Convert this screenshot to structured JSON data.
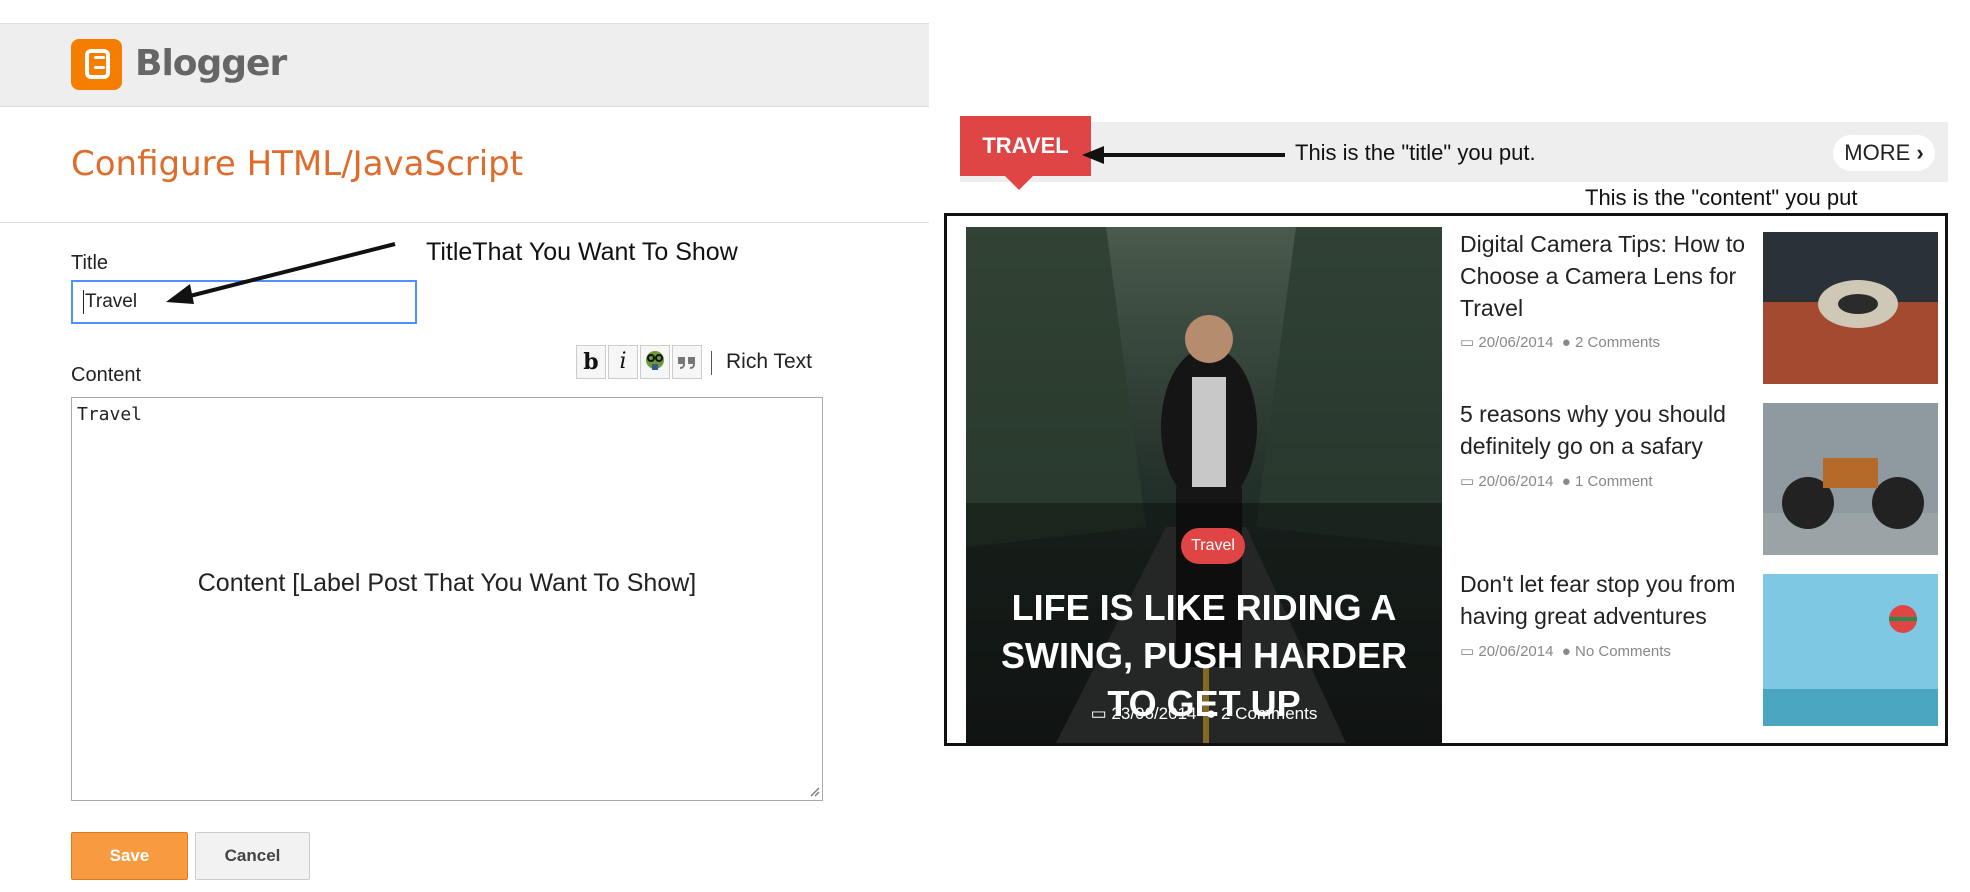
{
  "blogger": {
    "brand": "Blogger",
    "page_title": "Configure HTML/JavaScript",
    "title_label": "Title",
    "title_value": "Travel",
    "content_label": "Content",
    "toolbar": {
      "bold": "b",
      "italic": "i",
      "rich_text": "Rich Text"
    },
    "content_value": "Travel",
    "save_label": "Save",
    "cancel_label": "Cancel"
  },
  "annotations": {
    "title_note": "TitleThat You Want To Show",
    "content_note": "Content [Label Post That You Want To Show]",
    "widget_title_note": "This is the \"title\" you put.",
    "widget_content_note": "This is the \"content\" you put"
  },
  "widget": {
    "heading": "TRAVEL",
    "more_label": "MORE",
    "featured": {
      "category": "Travel",
      "title": "LIFE IS LIKE RIDING A SWING, PUSH HARDER TO GET UP",
      "date": "23/06/2014",
      "comments": "2 Comments"
    },
    "posts": [
      {
        "title": "Digital Camera Tips: How to Choose a Camera Lens for Travel",
        "date": "20/06/2014",
        "comments": "2 Comments"
      },
      {
        "title": "5 reasons why you should definitely go on a safary",
        "date": "20/06/2014",
        "comments": "1 Comment"
      },
      {
        "title": "Don't let fear stop you from having great adventures",
        "date": "20/06/2014",
        "comments": "No Comments"
      }
    ]
  },
  "colors": {
    "blogger_orange": "#f57d00",
    "title_orange": "#e06c2c",
    "accent_red": "#e04545",
    "input_focus": "#4d90fe"
  }
}
